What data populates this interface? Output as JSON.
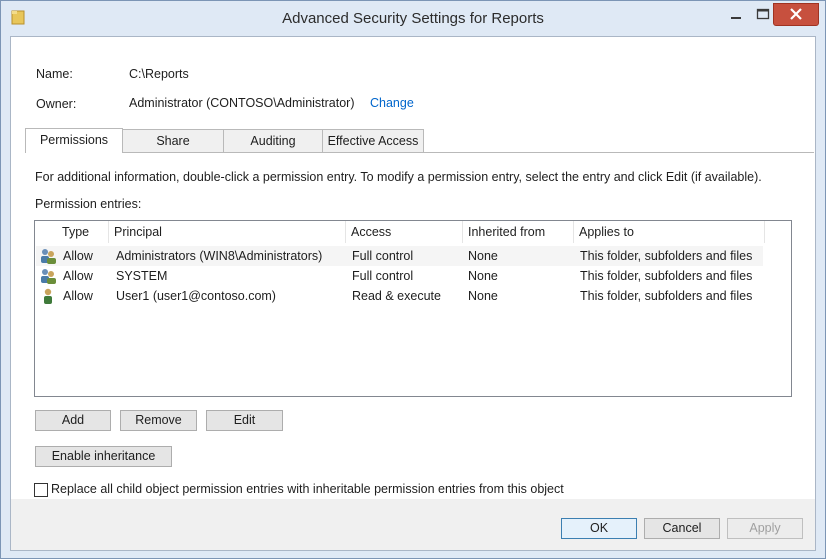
{
  "window": {
    "title": "Advanced Security Settings for Reports",
    "controls": {
      "minimize": "minimize",
      "maximize": "maximize",
      "close": "close"
    },
    "accent_close": "#c7503e"
  },
  "info": {
    "name_label": "Name:",
    "name_value": "C:\\Reports",
    "owner_label": "Owner:",
    "owner_value": "Administrator (CONTOSO\\Administrator)",
    "change_link": "Change"
  },
  "tabs": [
    {
      "label": "Permissions",
      "active": true
    },
    {
      "label": "Share",
      "active": false
    },
    {
      "label": "Auditing",
      "active": false
    },
    {
      "label": "Effective Access",
      "active": false
    }
  ],
  "permissions": {
    "info_text": "For additional information, double-click a permission entry. To modify a permission entry, select the entry and click Edit (if available).",
    "entries_label": "Permission entries:",
    "columns": [
      "Type",
      "Principal",
      "Access",
      "Inherited from",
      "Applies to"
    ],
    "rows": [
      {
        "icon": "group-users-icon",
        "type": "Allow",
        "principal": "Administrators (WIN8\\Administrators)",
        "access": "Full control",
        "inherited": "None",
        "applies": "This folder, subfolders and files"
      },
      {
        "icon": "group-users-icon",
        "type": "Allow",
        "principal": "SYSTEM",
        "access": "Full control",
        "inherited": "None",
        "applies": "This folder, subfolders and files"
      },
      {
        "icon": "single-user-icon",
        "type": "Allow",
        "principal": "User1 (user1@contoso.com)",
        "access": "Read & execute",
        "inherited": "None",
        "applies": "This folder, subfolders and files"
      }
    ],
    "buttons": {
      "add": "Add",
      "remove": "Remove",
      "edit": "Edit",
      "enable_inheritance": "Enable inheritance"
    },
    "replace_checkbox": {
      "label": "Replace all child object permission entries with inheritable permission entries from this object",
      "checked": false
    }
  },
  "footer": {
    "ok": "OK",
    "cancel": "Cancel",
    "apply": "Apply"
  }
}
